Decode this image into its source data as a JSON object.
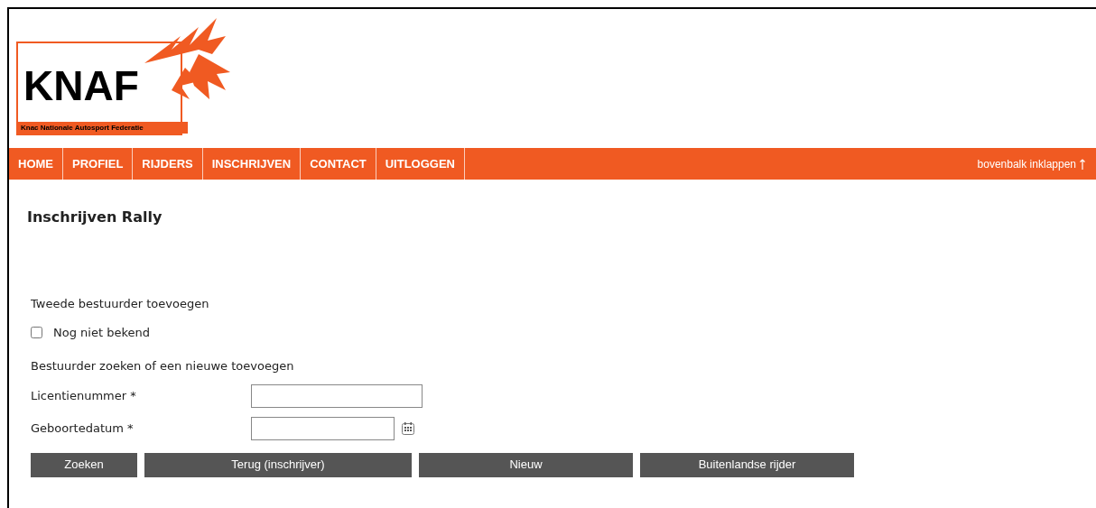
{
  "logo": {
    "name": "KNAF",
    "subtitle": "Knac Nationale Autosport Federatie"
  },
  "nav": {
    "items": [
      {
        "label": "HOME"
      },
      {
        "label": "PROFIEL"
      },
      {
        "label": "RIJDERS"
      },
      {
        "label": "INSCHRIJVEN"
      },
      {
        "label": "CONTACT"
      },
      {
        "label": "UITLOGGEN"
      }
    ],
    "collapse": "bovenbalk inklappen"
  },
  "title": "Inschrijven Rally",
  "second_driver": {
    "heading": "Tweede bestuurder toevoegen",
    "checkbox": {
      "label": "Nog niet bekend",
      "checked": false
    }
  },
  "search": {
    "heading": "Bestuurder zoeken of een nieuwe toevoegen",
    "fields": [
      {
        "label": "Licentienummer *",
        "kind": "text"
      },
      {
        "label": "Geboortedatum *",
        "kind": "date"
      }
    ]
  },
  "buttons": [
    {
      "label": "Zoeken"
    },
    {
      "label": "Terug (inschrijver)"
    },
    {
      "label": "Nieuw"
    },
    {
      "label": "Buitenlandse rijder"
    }
  ]
}
